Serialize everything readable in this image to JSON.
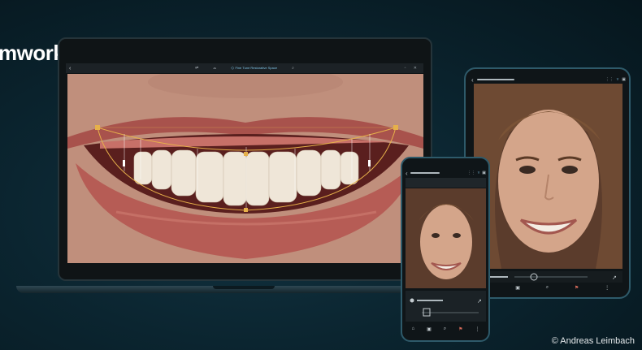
{
  "heading": "mwork",
  "laptop": {
    "toolbar": {
      "back_icon": "‹",
      "tool_icons": [
        "⇄",
        "⌓",
        "◇"
      ],
      "title": "Fine Tune Restorative Space",
      "search_icon": "⌕",
      "window_icons": "▫ ✕"
    }
  },
  "tablet": {
    "back_icon": "‹",
    "toolbar_icons": [
      "⋮⋮",
      "▿",
      "▣"
    ],
    "nav_icons": [
      "⌂",
      "▣",
      "⌕",
      "⚑",
      "⋮"
    ]
  },
  "phone": {
    "back_icon": "‹",
    "toolbar_icons": [
      "⋮⋮",
      "▿",
      "▣"
    ],
    "nav_icons": [
      "⌂",
      "▣",
      "⌕",
      "⚑",
      "⋮"
    ]
  },
  "credit": "© Andreas Leimbach",
  "colors": {
    "accent": "#7fc4e6",
    "guide": "#e6b04a",
    "device_frame": "#2e5a6a"
  }
}
